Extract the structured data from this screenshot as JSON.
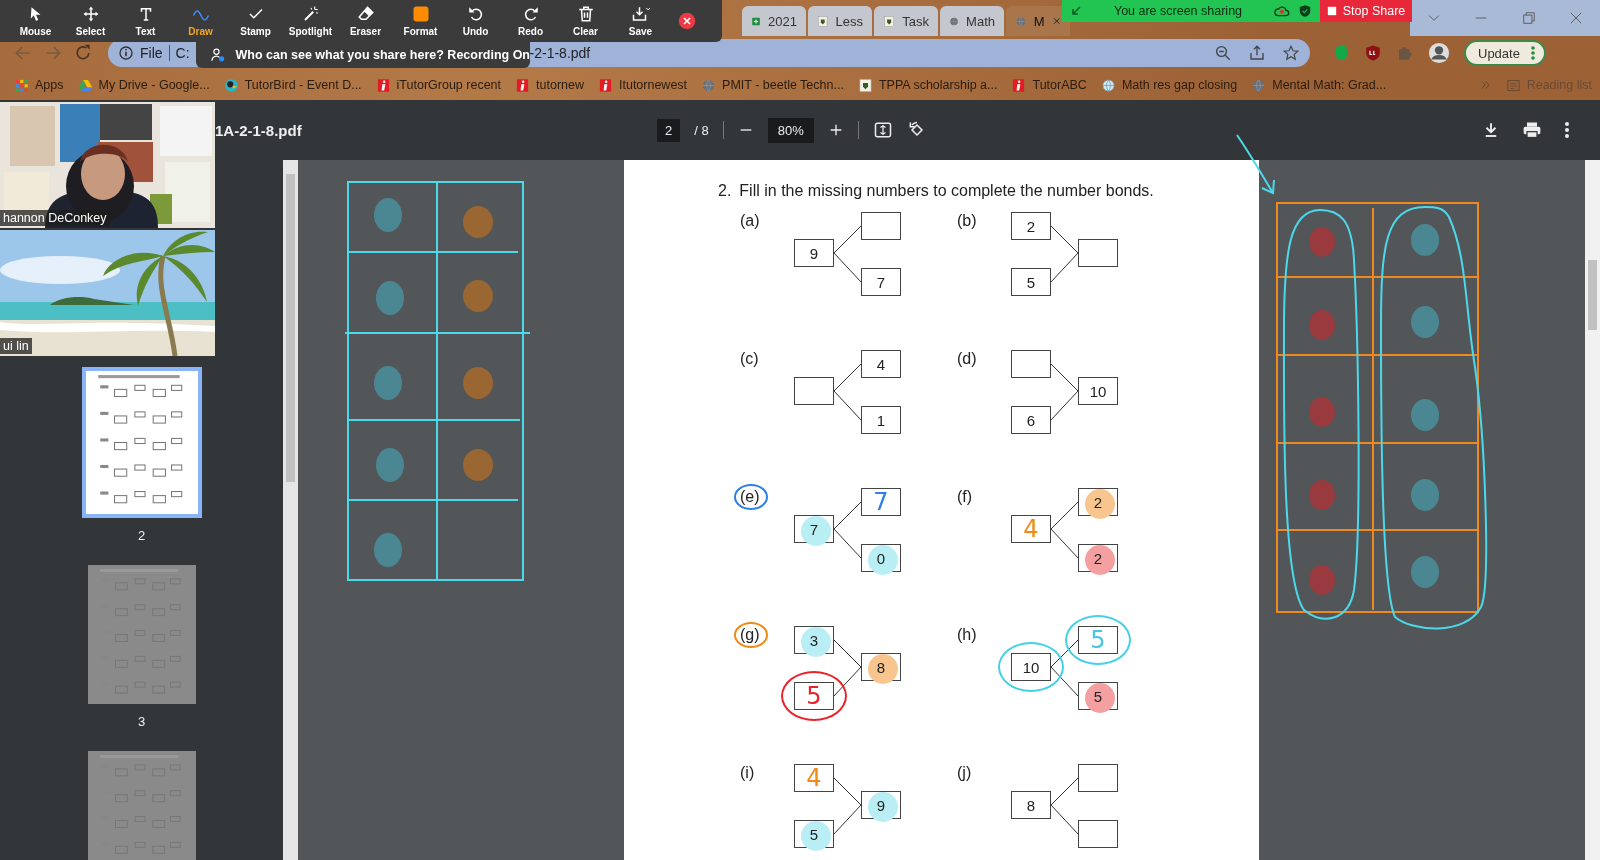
{
  "browser": {
    "tabs": [
      {
        "label": "2021",
        "kind": "sheets",
        "selected": false
      },
      {
        "label": "Less",
        "kind": "crest",
        "selected": false
      },
      {
        "label": "Task",
        "kind": "crest",
        "selected": false
      },
      {
        "label": "Math",
        "kind": "globe",
        "selected": false
      },
      {
        "label": "M",
        "kind": "globe",
        "selected": true
      }
    ],
    "address": {
      "scheme": "File",
      "path_start": "C:",
      "path_end": "-2-1-8.pdf"
    },
    "update_button": "Update",
    "bookmarks": [
      {
        "label": "Apps",
        "kind": "apps"
      },
      {
        "label": "My Drive - Google...",
        "kind": "drive"
      },
      {
        "label": "TutorBird - Event D...",
        "kind": "bird"
      },
      {
        "label": "iTutorGroup recent",
        "kind": "itutor"
      },
      {
        "label": "tutornew",
        "kind": "itutor"
      },
      {
        "label": "Itutornewest",
        "kind": "itutor"
      },
      {
        "label": "PMIT - beetle Techn...",
        "kind": "globe"
      },
      {
        "label": "TPPA scholarship a...",
        "kind": "crest"
      },
      {
        "label": "TutorABC",
        "kind": "itutor"
      },
      {
        "label": "Math res gap closing",
        "kind": "earth"
      },
      {
        "label": "Mental Math: Grad...",
        "kind": "globe"
      }
    ],
    "reading_list": "Reading list"
  },
  "zoom_toolbar": {
    "tools": [
      {
        "label": "Mouse",
        "kind": "pointer",
        "selected": false
      },
      {
        "label": "Select",
        "kind": "move",
        "selected": false
      },
      {
        "label": "Text",
        "kind": "text",
        "selected": false
      },
      {
        "label": "Draw",
        "kind": "squiggle",
        "selected": true
      },
      {
        "label": "Stamp",
        "kind": "check",
        "selected": false
      },
      {
        "label": "Spotlight",
        "kind": "wand",
        "selected": false
      },
      {
        "label": "Eraser",
        "kind": "eraser",
        "selected": false
      },
      {
        "label": "Format",
        "kind": "swatch",
        "selected": false
      },
      {
        "label": "Undo",
        "kind": "undo",
        "selected": false
      },
      {
        "label": "Redo",
        "kind": "redo",
        "selected": false
      },
      {
        "label": "Clear",
        "kind": "trash",
        "selected": false
      },
      {
        "label": "Save",
        "kind": "save",
        "selected": false
      }
    ],
    "notice": "Who can see what you share here? Recording On"
  },
  "sharing_bar": {
    "status": "You are screen sharing",
    "stop_button": "Stop Share"
  },
  "videos": [
    {
      "name": "hannon DeConkey",
      "kind": "person"
    },
    {
      "name": "ui lin",
      "kind": "beach"
    }
  ],
  "pdf_viewer": {
    "file_name": "1A-2-1-8.pdf",
    "page": "2",
    "page_count": "/ 8",
    "zoom": "80%",
    "thumbnails": [
      {
        "label": "2",
        "selected": true
      },
      {
        "label": "3",
        "selected": false
      },
      {
        "selected": false
      }
    ]
  },
  "worksheet": {
    "number": "2.",
    "question": "Fill in the missing numbers to complete the number bonds.",
    "bonds": [
      {
        "label": {
          "text": "(a)"
        },
        "kind": "split",
        "whole": {
          "kind": "printed",
          "text": "9"
        },
        "parts": [
          {
            "kind": "blank"
          },
          {
            "kind": "printed",
            "text": "7"
          }
        ]
      },
      {
        "label": {
          "text": "(b)"
        },
        "kind": "join",
        "whole": {
          "kind": "blank"
        },
        "parts": [
          {
            "kind": "printed",
            "text": "2"
          },
          {
            "kind": "printed",
            "text": "5"
          }
        ]
      },
      {
        "label": {
          "text": "(c)"
        },
        "kind": "split",
        "whole": {
          "kind": "blank"
        },
        "parts": [
          {
            "kind": "printed",
            "text": "4"
          },
          {
            "kind": "printed",
            "text": "1"
          }
        ]
      },
      {
        "label": {
          "text": "(d)"
        },
        "kind": "join",
        "whole": {
          "kind": "printed",
          "text": "10"
        },
        "parts": [
          {
            "kind": "blank"
          },
          {
            "kind": "printed",
            "text": "6"
          }
        ]
      },
      {
        "label": {
          "text": "(e)",
          "marks": [
            {
              "kind": "ring",
              "color": "#2f7fe8"
            }
          ]
        },
        "kind": "split",
        "whole": {
          "kind": "printed",
          "text": "7",
          "marks": [
            {
              "kind": "highlight",
              "color": "#b8eef4"
            }
          ]
        },
        "parts": [
          {
            "kind": "written",
            "text": "7",
            "color": "#2f7fe8"
          },
          {
            "kind": "printed",
            "text": "0",
            "marks": [
              {
                "kind": "highlight",
                "color": "#b8eef4"
              }
            ]
          }
        ]
      },
      {
        "label": {
          "text": "(f)"
        },
        "kind": "split",
        "whole": {
          "kind": "written",
          "text": "4",
          "color": "#f08a12"
        },
        "parts": [
          {
            "kind": "printed",
            "text": "2",
            "marks": [
              {
                "kind": "highlight",
                "color": "#f8c58e"
              }
            ]
          },
          {
            "kind": "printed",
            "text": "2",
            "marks": [
              {
                "kind": "highlight",
                "color": "#f5a0a0"
              }
            ]
          }
        ]
      },
      {
        "label": {
          "text": "(g)",
          "marks": [
            {
              "kind": "ring",
              "color": "#f08a12"
            }
          ]
        },
        "kind": "join",
        "whole": {
          "kind": "printed",
          "text": "8",
          "marks": [
            {
              "kind": "highlight",
              "color": "#f8c58e"
            }
          ]
        },
        "parts": [
          {
            "kind": "printed",
            "text": "3",
            "marks": [
              {
                "kind": "highlight",
                "color": "#b8eef4"
              }
            ]
          },
          {
            "kind": "written",
            "text": "5",
            "color": "#e8232a",
            "marks": [
              {
                "kind": "ring",
                "color": "#e8232a"
              }
            ]
          }
        ]
      },
      {
        "label": {
          "text": "(h)"
        },
        "kind": "split",
        "whole": {
          "kind": "printed",
          "text": "10",
          "marks": [
            {
              "kind": "ring",
              "color": "#45d0e6"
            }
          ]
        },
        "parts": [
          {
            "kind": "written",
            "text": "5",
            "color": "#45c8e0",
            "marks": [
              {
                "kind": "ring",
                "color": "#45d0e6"
              }
            ]
          },
          {
            "kind": "printed",
            "text": "5",
            "marks": [
              {
                "kind": "highlight",
                "color": "#f5a0a0"
              }
            ]
          }
        ]
      },
      {
        "label": {
          "text": "(i)"
        },
        "kind": "join",
        "whole": {
          "kind": "printed",
          "text": "9",
          "marks": [
            {
              "kind": "highlight",
              "color": "#b8eef4"
            }
          ]
        },
        "parts": [
          {
            "kind": "written",
            "text": "4",
            "color": "#f08a12"
          },
          {
            "kind": "printed",
            "text": "5",
            "marks": [
              {
                "kind": "highlight",
                "color": "#b8eef4"
              }
            ]
          }
        ]
      },
      {
        "label": {
          "text": "(j)"
        },
        "kind": "split",
        "whole": {
          "kind": "printed",
          "text": "8"
        },
        "parts": [
          {
            "kind": "blank"
          },
          {
            "kind": "blank"
          }
        ]
      }
    ]
  }
}
